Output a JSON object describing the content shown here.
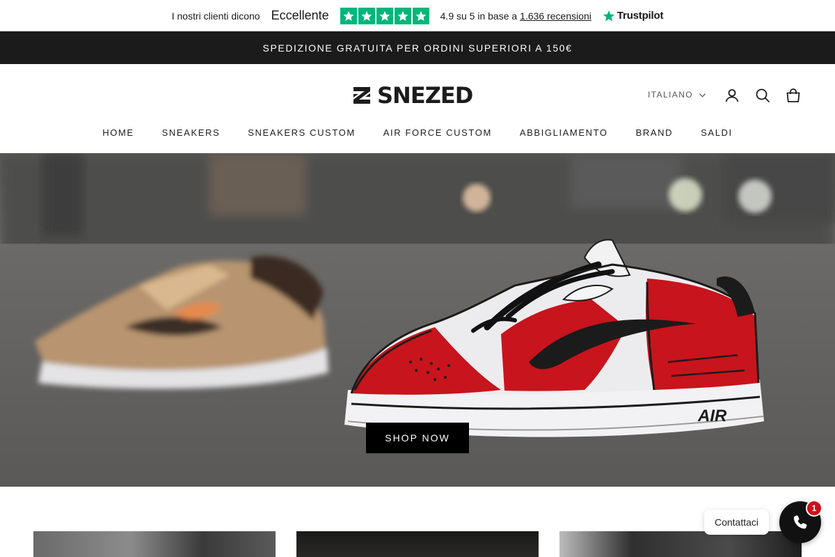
{
  "trustpilot": {
    "lead": "I nostri clienti dicono",
    "rating_word": "Eccellente",
    "stars": 5,
    "score_text": "4.9 su 5 in base a",
    "reviews_link": "1.636 recensioni",
    "brand": "Trustpilot",
    "star_color": "#00b67a"
  },
  "announcement": {
    "text": "SPEDIZIONE GRATUITA PER ORDINI SUPERIORI A 150€"
  },
  "header": {
    "logo_text": "SNEZED",
    "language": "ITALIANO",
    "icons": [
      "account-icon",
      "search-icon",
      "cart-icon"
    ]
  },
  "nav": {
    "items": [
      {
        "label": "HOME"
      },
      {
        "label": "SNEAKERS"
      },
      {
        "label": "SNEAKERS CUSTOM"
      },
      {
        "label": "AIR FORCE CUSTOM"
      },
      {
        "label": "ABBIGLIAMENTO"
      },
      {
        "label": "BRAND"
      },
      {
        "label": "SALDI"
      }
    ]
  },
  "hero": {
    "cta_label": "SHOP NOW",
    "shoe_text": "AIR"
  },
  "chat": {
    "label": "Contattaci",
    "badge_count": "1"
  },
  "colors": {
    "announcement_bg": "#1b1b1b",
    "hero_shoe_red": "#c8141c",
    "chat_badge": "#d00f1a"
  }
}
